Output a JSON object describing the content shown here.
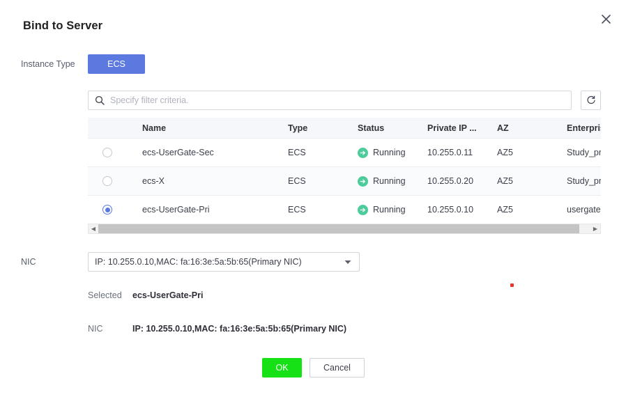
{
  "dialog": {
    "title": "Bind to Server",
    "close_icon": "close-icon"
  },
  "instance_type": {
    "label": "Instance Type",
    "selected": "ECS",
    "options": [
      "ECS"
    ]
  },
  "filter": {
    "placeholder": "Specify filter criteria.",
    "value": "",
    "search_icon": "search-icon",
    "refresh_icon": "refresh-icon"
  },
  "table": {
    "columns": [
      "",
      "Name",
      "Type",
      "Status",
      "Private IP ...",
      "AZ",
      "Enterprise Project"
    ],
    "rows": [
      {
        "selected": false,
        "name": "ecs-UserGate-Sec",
        "type": "ECS",
        "status": "Running",
        "private_ip": "10.255.0.11",
        "az": "AZ5",
        "enterprise_project": "Study_project"
      },
      {
        "selected": false,
        "name": "ecs-X",
        "type": "ECS",
        "status": "Running",
        "private_ip": "10.255.0.20",
        "az": "AZ5",
        "enterprise_project": "Study_project"
      },
      {
        "selected": true,
        "name": "ecs-UserGate-Pri",
        "type": "ECS",
        "status": "Running",
        "private_ip": "10.255.0.10",
        "az": "AZ5",
        "enterprise_project": "usergate"
      }
    ],
    "status_icon": "arrow-right-circle-icon"
  },
  "nic": {
    "label": "NIC",
    "selected": "IP: 10.255.0.10,MAC: fa:16:3e:5a:5b:65(Primary NIC)",
    "caret_icon": "chevron-down-icon"
  },
  "summary": {
    "selected_label": "Selected",
    "selected_value": "ecs-UserGate-Pri",
    "nic_label": "NIC",
    "nic_value": "IP: 10.255.0.10,MAC: fa:16:3e:5a:5b:65(Primary NIC)"
  },
  "footer": {
    "ok_label": "OK",
    "cancel_label": "Cancel"
  },
  "colors": {
    "accent_blue": "#5b79de",
    "ok_green": "#16e016",
    "status_green": "#4ecb9a",
    "header_bg": "#f5f7fb",
    "red_marker": "#e8342a"
  }
}
